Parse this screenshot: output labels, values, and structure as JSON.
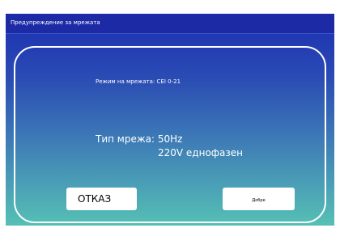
{
  "dialog": {
    "title": "Предупреждение за мрежата",
    "mode_text": "Режим на мрежата: CEI 0-21",
    "grid_type_text": "Тип мрежа: 50Hz",
    "grid_phase_text": "220V еднофазен",
    "cancel_label": "ОТКАЗ",
    "ok_label": "Добре"
  },
  "colors": {
    "titlebar": "#1d2aa6",
    "gradient_top": "#1b2eb0",
    "gradient_bottom": "#56c0b5",
    "text": "#ffffff",
    "button_bg": "#ffffff"
  }
}
